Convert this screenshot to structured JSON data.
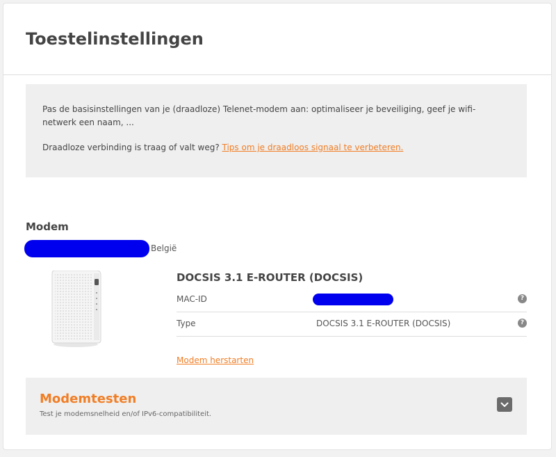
{
  "page": {
    "title": "Toestelinstellingen"
  },
  "info": {
    "text1": "Pas de basisinstellingen van je (draadloze) Telenet-modem aan: optimaliseer je beveiliging, geef je wifi-netwerk een naam, ...",
    "text2_prefix": "Draadloze verbinding is traag of valt weg?",
    "text2_link": "Tips om je draadloos signaal te verbeteren."
  },
  "modem": {
    "section_title": "Modem",
    "country": "België",
    "device_name": "DOCSIS 3.1 E-ROUTER (DOCSIS)",
    "rows": [
      {
        "label": "MAC-ID",
        "value": ""
      },
      {
        "label": "Type",
        "value": "DOCSIS 3.1 E-ROUTER (DOCSIS)"
      }
    ],
    "help_glyph": "?",
    "restart_link": "Modem herstarten"
  },
  "tests": {
    "title": "Modemtesten",
    "subtitle": "Test je modemsnelheid en/of IPv6-compatibiliteit."
  },
  "colors": {
    "accent": "#f07e26",
    "redaction": "#0000ee"
  }
}
